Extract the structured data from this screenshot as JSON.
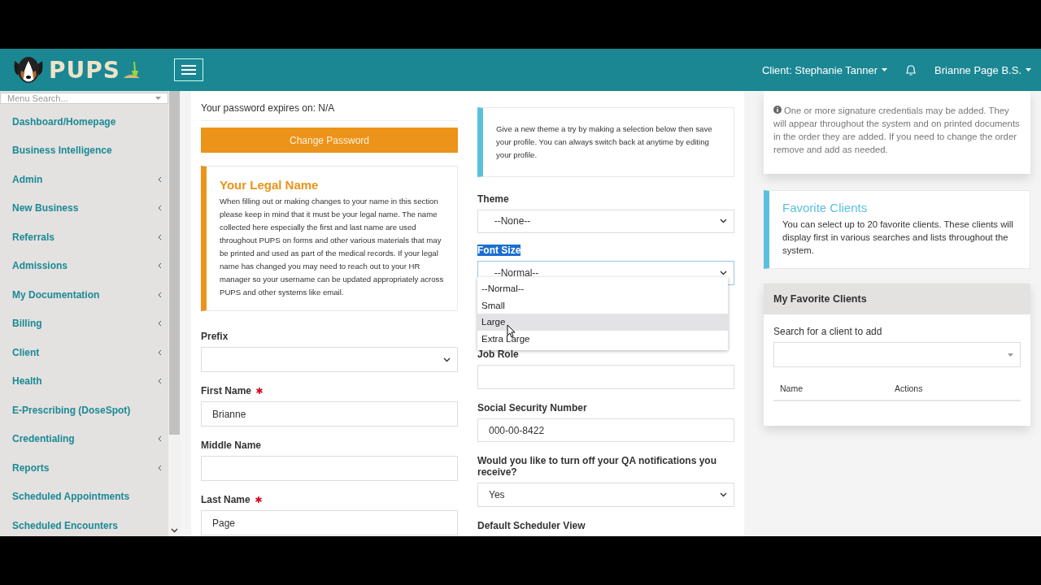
{
  "header": {
    "logo_text": "PUPS",
    "client": "Client: Stephanie Tanner",
    "user": "Brianne Page B.S."
  },
  "sidebar": {
    "search_placeholder": "Menu Search...",
    "items": [
      {
        "label": "Dashboard/Homepage",
        "expandable": false
      },
      {
        "label": "Business Intelligence",
        "expandable": false
      },
      {
        "label": "Admin",
        "expandable": true
      },
      {
        "label": "New Business",
        "expandable": true
      },
      {
        "label": "Referrals",
        "expandable": true
      },
      {
        "label": "Admissions",
        "expandable": true
      },
      {
        "label": "My Documentation",
        "expandable": true
      },
      {
        "label": "Billing",
        "expandable": true
      },
      {
        "label": "Client",
        "expandable": true
      },
      {
        "label": "Health",
        "expandable": true
      },
      {
        "label": "E-Prescribing (DoseSpot)",
        "expandable": false
      },
      {
        "label": "Credentialing",
        "expandable": true
      },
      {
        "label": "Reports",
        "expandable": true
      },
      {
        "label": "Scheduled Appointments",
        "expandable": false
      },
      {
        "label": "Scheduled Encounters",
        "expandable": false
      }
    ]
  },
  "column_1": {
    "password_expiry": "Your password expires on: N/A",
    "change_password_button": "Change Password",
    "legal_name_callout": {
      "title": "Your Legal Name",
      "text": "When filling out or making changes to your name in this section please keep in mind that it must be your legal name. The name collected here especially the first and last name are used throughout PUPS on forms and other various materials that may be printed and used as part of the medical records. If your legal name has changed you may need to reach out to your HR manager so your username can be updated appropriately across PUPS and other systems like email."
    },
    "fields": [
      {
        "kind": "select",
        "label": "Prefix",
        "required": false
      },
      {
        "kind": "input",
        "label": "First Name",
        "required": true,
        "value": "Brianne"
      },
      {
        "kind": "input",
        "label": "Middle Name",
        "required": false
      },
      {
        "kind": "input",
        "label": "Last Name",
        "required": true,
        "value": "Page"
      }
    ]
  },
  "column_2": {
    "theme_callout": "Give a new theme a try by making a selection below then save your profile. You can always switch back at anytime by editing your profile.",
    "theme": {
      "label": "Theme",
      "value": "--None--"
    },
    "font_size": {
      "label": "Font Size",
      "label_selected": true,
      "value": "--Normal--",
      "options": [
        {
          "label": "--Normal--",
          "highlighted": false
        },
        {
          "label": "Small",
          "highlighted": false
        },
        {
          "label": "Large",
          "highlighted": true
        },
        {
          "label": "Extra Large",
          "highlighted": false
        }
      ]
    },
    "fields": [
      {
        "kind": "input",
        "label": "Job Role"
      },
      {
        "kind": "input",
        "label": "Social Security Number",
        "value": "000-00-8422"
      },
      {
        "kind": "select",
        "label": "Would you like to turn off your QA notifications you receive?",
        "value": "Yes"
      },
      {
        "kind": "label",
        "label": "Default Scheduler View"
      }
    ]
  },
  "column_3": {
    "credentials_note": "One or more signature credentials may be added. They will appear throughout the system and on printed documents in the order they are added. If you need to change the order remove and add as needed.",
    "favorite_callout": {
      "title": "Favorite Clients",
      "text": "You can select up to 20 favorite clients. These clients will display first in various searches and lists throughout the system."
    },
    "favorites_panel": {
      "title": "My Favorite Clients",
      "search_label": "Search for a client to add",
      "columns": [
        "Name",
        "Actions"
      ]
    }
  }
}
